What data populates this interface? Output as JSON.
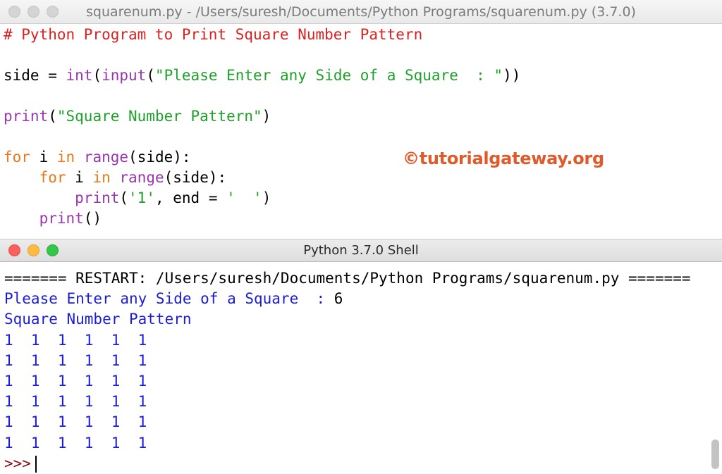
{
  "editor": {
    "title": "squarenum.py - /Users/suresh/Documents/Python Programs/squarenum.py (3.7.0)",
    "code": {
      "comment": "# Python Program to Print Square Number Pattern",
      "l3_a": "side = ",
      "l3_int": "int",
      "l3_b": "(",
      "l3_input": "input",
      "l3_c": "(",
      "l3_str": "\"Please Enter any Side of a Square  : \"",
      "l3_d": "))",
      "l5_print": "print",
      "l5_a": "(",
      "l5_str": "\"Square Number Pattern\"",
      "l5_b": ")",
      "l7_for": "for",
      "l7_a": " i ",
      "l7_in": "in",
      "l7_b": " ",
      "l7_range": "range",
      "l7_c": "(side):",
      "l8_indent": "    ",
      "l8_for": "for",
      "l8_a": " i ",
      "l8_in": "in",
      "l8_b": " ",
      "l8_range": "range",
      "l8_c": "(side):",
      "l9_indent": "        ",
      "l9_print": "print",
      "l9_a": "(",
      "l9_str1": "'1'",
      "l9_b": ", end = ",
      "l9_str2": "'  '",
      "l9_c": ")",
      "l10_indent": "    ",
      "l10_print": "print",
      "l10_a": "()"
    },
    "watermark": "©tutorialgateway.org"
  },
  "shell": {
    "title": "Python 3.7.0 Shell",
    "restart_line": "======= RESTART: /Users/suresh/Documents/Python Programs/squarenum.py =======",
    "input_prompt": "Please Enter any Side of a Square  : ",
    "input_value": "6",
    "heading": "Square Number Pattern",
    "pattern_rows": [
      "1  1  1  1  1  1",
      "1  1  1  1  1  1",
      "1  1  1  1  1  1",
      "1  1  1  1  1  1",
      "1  1  1  1  1  1",
      "1  1  1  1  1  1"
    ],
    "prompt": ">>>"
  },
  "colors": {
    "keyword": "#e8781a",
    "builtin": "#9a35b0",
    "string": "#1fa02a",
    "comment": "#dd1f1f",
    "output": "#1b1bdc",
    "prompt": "#8b1010"
  }
}
